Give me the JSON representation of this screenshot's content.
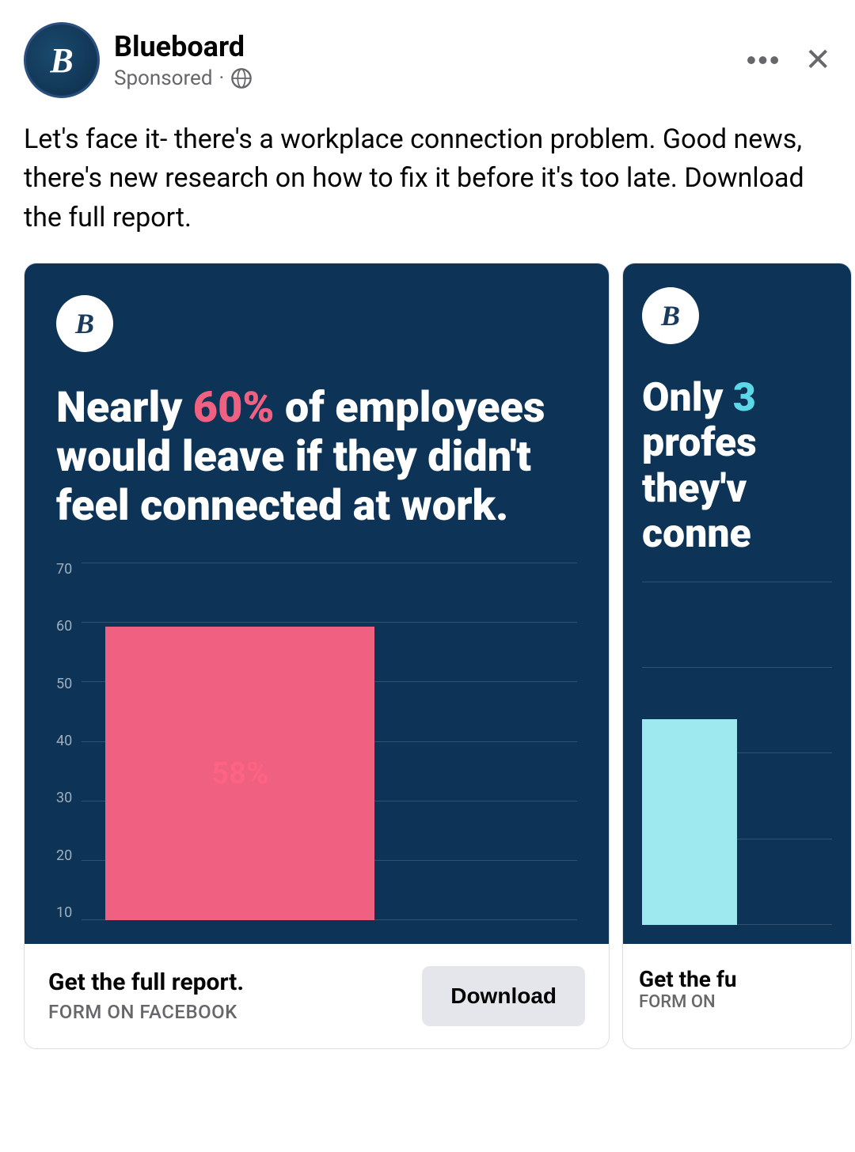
{
  "header": {
    "brand_name": "Blueboard",
    "sponsored_label": "Sponsored",
    "dots_label": "•••",
    "close_label": "✕"
  },
  "post": {
    "text": "Let's face it- there's a workplace connection problem. Good news, there's new research on how to fix it before it's too late. Download the full report."
  },
  "card_main": {
    "headline_part1": "Nearly ",
    "headline_highlight": "60%",
    "headline_part2": " of employees would leave if they didn't feel connected at work.",
    "chart": {
      "y_labels": [
        "70",
        "60",
        "50",
        "40",
        "30",
        "20",
        "10"
      ],
      "bar_label": "58%",
      "bar_percent": 82
    },
    "footer": {
      "title": "Get the full report.",
      "sub": "FORM ON FACEBOOK",
      "cta": "Download"
    }
  },
  "card_secondary": {
    "headline_part1": "Only ",
    "headline_highlight": "3",
    "headline_rest": "profes they'v conne",
    "footer": {
      "title": "Get the fu",
      "sub": "FORM ON"
    }
  }
}
